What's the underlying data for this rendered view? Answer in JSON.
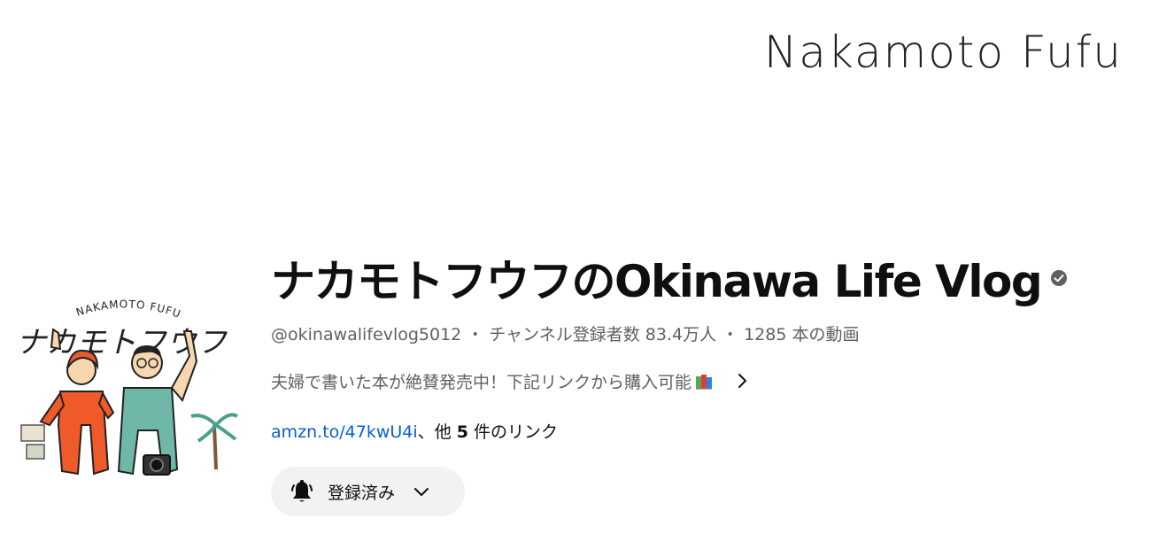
{
  "banner": {
    "text": "Nakamoto Fufu"
  },
  "avatar": {
    "top_text": "NAKAMOTO FUFU",
    "katakana": "ナカモトフウフ"
  },
  "channel": {
    "title": "ナカモトフウフのOkinawa Life Vlog",
    "handle": "@okinawalifevlog5012",
    "separator": "・",
    "subscribers": "チャンネル登録者数 83.4万人",
    "videos": "1285 本の動画",
    "description": "夫婦で書いた本が絶賛発売中！下記リンクから購入可能",
    "link_url": "amzn.to/47kwU4i",
    "link_suffix_before": "、他 ",
    "link_count": "5",
    "link_suffix_after": " 件のリンク"
  },
  "subscribe": {
    "label": "登録済み"
  },
  "icons": {
    "verified": "verified-check-icon",
    "book": "books-icon",
    "more": "chevron-right-icon",
    "bell": "bell-icon",
    "dropdown": "chevron-down-icon"
  },
  "colors": {
    "link": "#065fd4",
    "secondary_text": "#606060",
    "button_bg": "#f2f2f2"
  }
}
